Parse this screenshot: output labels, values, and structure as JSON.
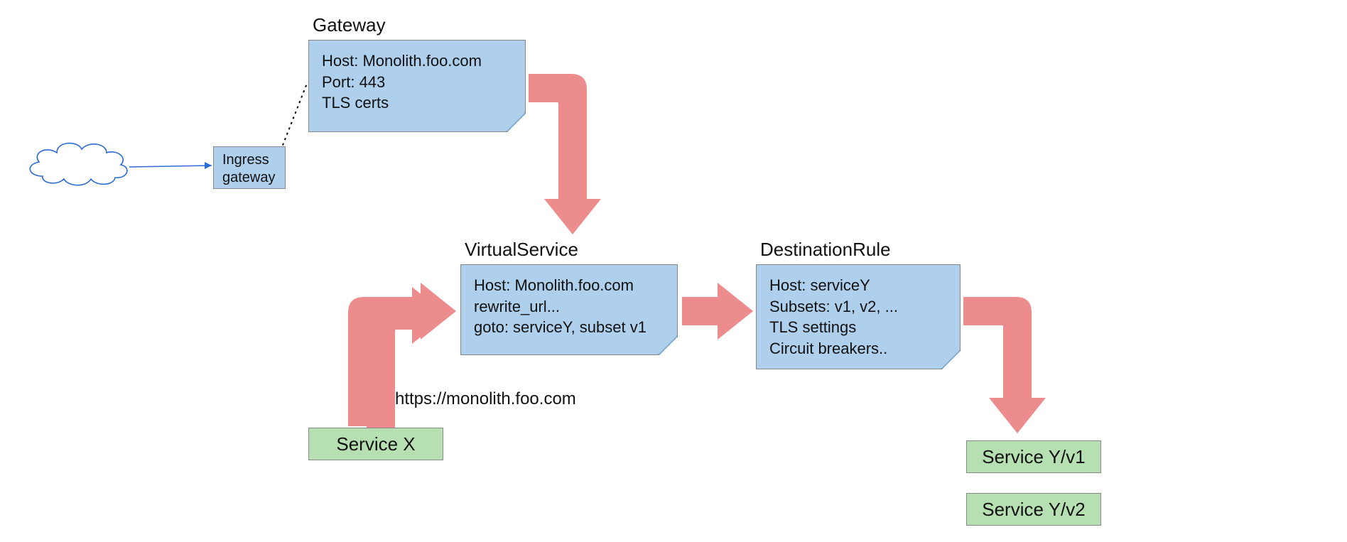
{
  "gateway": {
    "title": "Gateway",
    "line1": "Host: Monolith.foo.com",
    "line2": "Port: 443",
    "line3": "TLS certs"
  },
  "virtualService": {
    "title": "VirtualService",
    "line1": "Host: Monolith.foo.com",
    "line2": "rewrite_url...",
    "line3": "goto: serviceY, subset v1"
  },
  "destinationRule": {
    "title": "DestinationRule",
    "line1": "Host: serviceY",
    "line2": "Subsets: v1, v2, ...",
    "line3": "TLS settings",
    "line4": "Circuit breakers.."
  },
  "ingress": {
    "line1": "Ingress",
    "line2": "gateway"
  },
  "serviceX": {
    "label": "Service X"
  },
  "serviceY1": {
    "label": "Service Y/v1"
  },
  "serviceY2": {
    "label": "Service Y/v2"
  },
  "url": {
    "text": "https://monolith.foo.com"
  }
}
